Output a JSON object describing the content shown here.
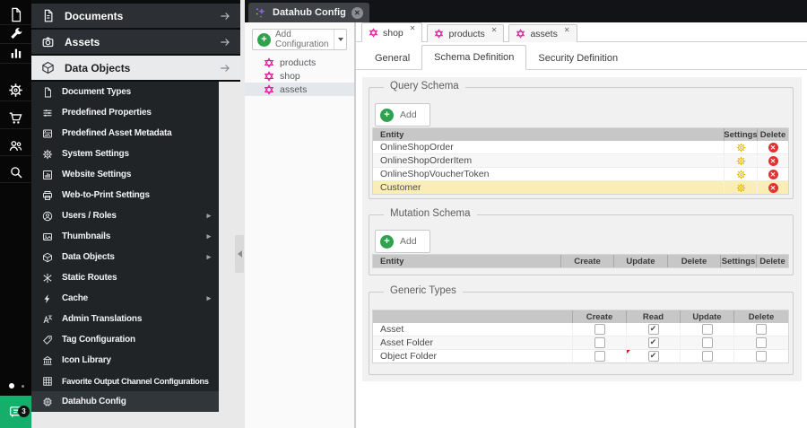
{
  "iconbar": {
    "chat_badge": "3"
  },
  "workspace_tab": {
    "label": "Datahub Config"
  },
  "sidebar": {
    "sections": [
      {
        "label": "Documents"
      },
      {
        "label": "Assets"
      },
      {
        "label": "Data Objects"
      }
    ],
    "active_section": "Data Objects",
    "items": [
      {
        "label": "Document Types"
      },
      {
        "label": "Predefined Properties"
      },
      {
        "label": "Predefined Asset Metadata"
      },
      {
        "label": "System Settings"
      },
      {
        "label": "Website Settings"
      },
      {
        "label": "Web-to-Print Settings"
      },
      {
        "label": "Users / Roles",
        "has_submenu": true
      },
      {
        "label": "Thumbnails",
        "has_submenu": true
      },
      {
        "label": "Data Objects",
        "has_submenu": true
      },
      {
        "label": "Static Routes"
      },
      {
        "label": "Cache",
        "has_submenu": true
      },
      {
        "label": "Admin Translations"
      },
      {
        "label": "Tag Configuration"
      },
      {
        "label": "Icon Library"
      },
      {
        "label": "Favorite Output Channel Configurations"
      },
      {
        "label": "Datahub Config"
      }
    ],
    "active_item": "Datahub Config"
  },
  "tree": {
    "add_button_label": "Add Configuration",
    "items": [
      {
        "label": "products"
      },
      {
        "label": "shop"
      },
      {
        "label": "assets"
      }
    ],
    "selected_item": "assets"
  },
  "main": {
    "tabs": [
      {
        "label": "shop"
      },
      {
        "label": "products"
      },
      {
        "label": "assets"
      }
    ],
    "active_tab": "shop",
    "subtabs": [
      {
        "label": "General"
      },
      {
        "label": "Schema Definition"
      },
      {
        "label": "Security Definition"
      }
    ],
    "active_subtab": "Schema Definition",
    "query_schema": {
      "legend": "Query Schema",
      "add_label": "Add",
      "columns": [
        "Entity",
        "Settings",
        "Delete"
      ],
      "rows": [
        {
          "entity": "OnlineShopOrder"
        },
        {
          "entity": "OnlineShopOrderItem"
        },
        {
          "entity": "OnlineShopVoucherToken"
        },
        {
          "entity": "Customer"
        }
      ],
      "highlighted_row": "Customer"
    },
    "mutation_schema": {
      "legend": "Mutation Schema",
      "add_label": "Add",
      "columns": [
        "Entity",
        "Create",
        "Update",
        "Delete",
        "Settings",
        "Delete"
      ],
      "rows": []
    },
    "generic_types": {
      "legend": "Generic Types",
      "columns": [
        "Create",
        "Read",
        "Update",
        "Delete"
      ],
      "rows": [
        {
          "label": "Asset",
          "create": false,
          "read": true,
          "update": false,
          "delete": false
        },
        {
          "label": "Asset Folder",
          "create": false,
          "read": true,
          "update": false,
          "delete": false
        },
        {
          "label": "Object Folder",
          "create": false,
          "read": true,
          "update": false,
          "delete": false,
          "modified": true
        }
      ]
    }
  },
  "colors": {
    "accent_green": "#2fa24f",
    "star_pink": "#e3199e",
    "settings_yellow": "#e2b400",
    "delete_red": "#e03232",
    "highlight_row_yellow": "#fbeeb4",
    "chat_green": "#16ae6b"
  }
}
